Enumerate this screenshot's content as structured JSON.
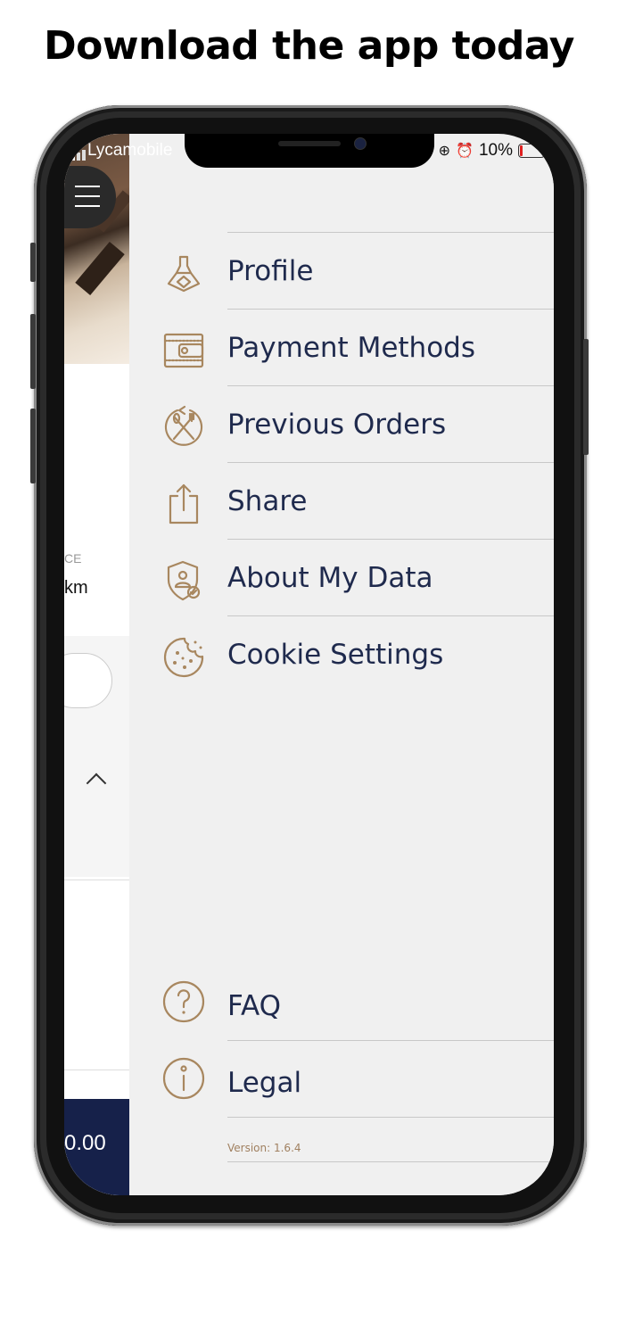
{
  "headline": "Download the app today",
  "status_bar": {
    "carrier": "Lycamobile",
    "battery": "10%"
  },
  "underlying_app": {
    "distance_caption": "CE",
    "distance_value": "km",
    "total": "0.00"
  },
  "menu": {
    "items": [
      {
        "label": "Profile",
        "icon": "profile-icon"
      },
      {
        "label": "Payment Methods",
        "icon": "wallet-icon"
      },
      {
        "label": "Previous Orders",
        "icon": "previous-orders-icon"
      },
      {
        "label": "Share",
        "icon": "share-icon"
      },
      {
        "label": "About My Data",
        "icon": "data-shield-icon"
      },
      {
        "label": "Cookie Settings",
        "icon": "cookie-icon"
      }
    ],
    "bottom_items": [
      {
        "label": "FAQ",
        "icon": "question-icon"
      },
      {
        "label": "Legal",
        "icon": "info-icon"
      }
    ],
    "version": "Version: 1.6.4"
  },
  "colors": {
    "accent": "#a8875f",
    "text": "#1f2a4d",
    "drawer_bg": "#f0f0f0",
    "total_bar": "#16214a"
  }
}
